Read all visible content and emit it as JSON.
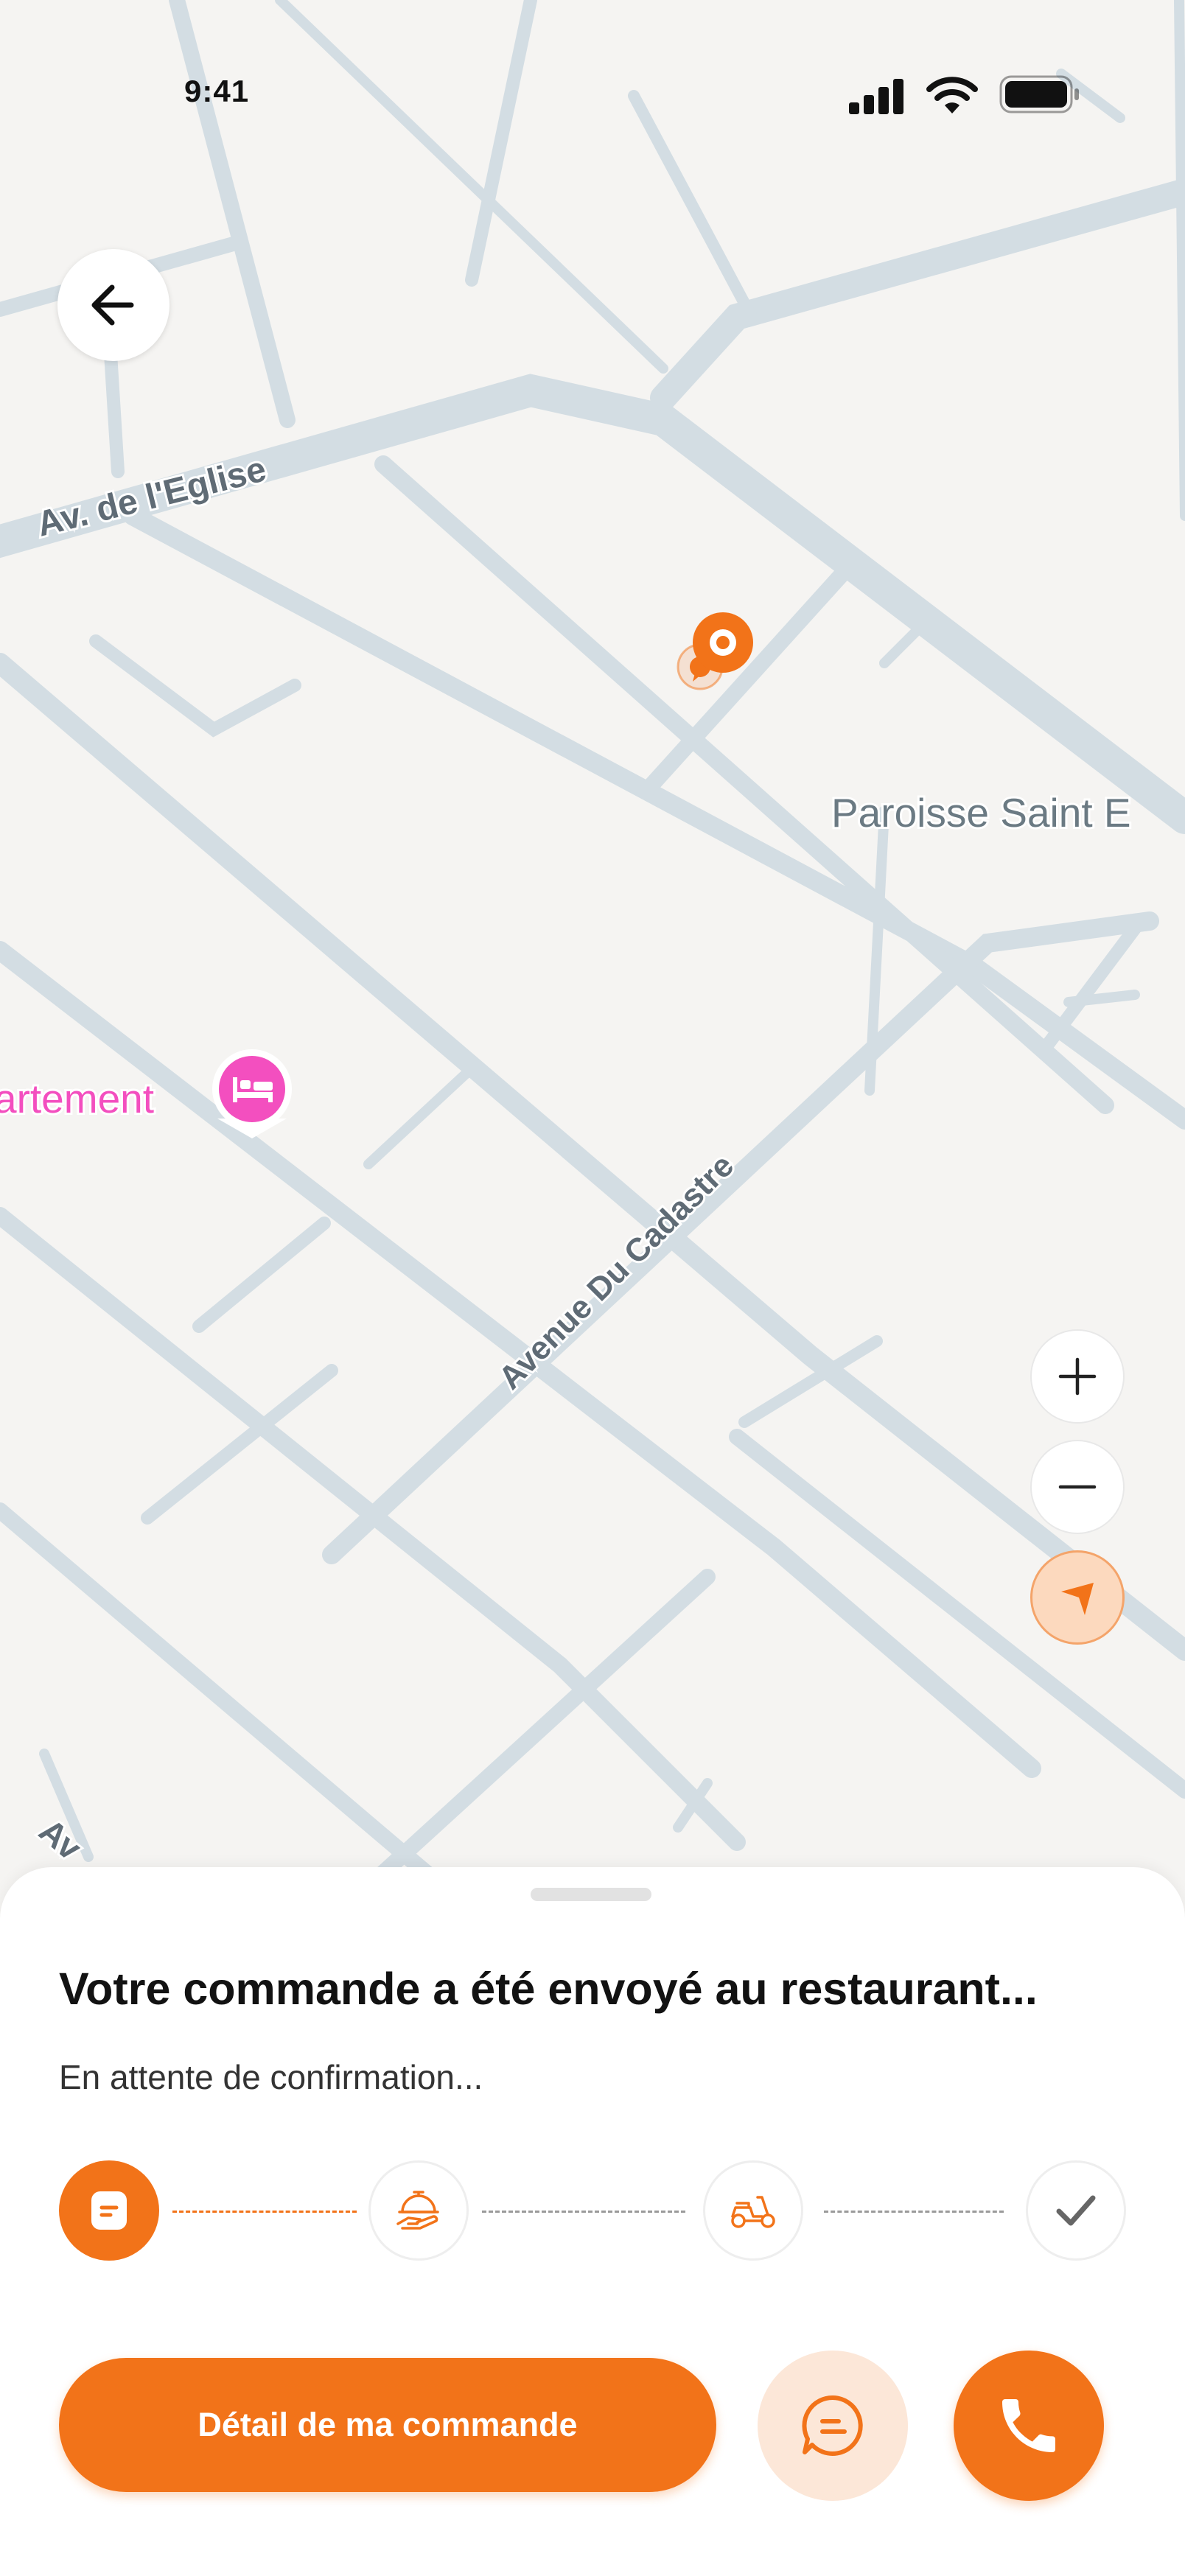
{
  "status_bar": {
    "time": "9:41"
  },
  "map": {
    "street_labels": [
      "Av. de l'Eglise",
      "Avenue Du Cadastre",
      "Av"
    ],
    "poi_labels": [
      "Paroisse Saint E",
      "artement"
    ],
    "colors": {
      "road": "#d3dde3",
      "background": "#f5f4f2",
      "accent": "#f27319",
      "poi_pink": "#f34fbf"
    }
  },
  "icons": {
    "back": "arrow-left-icon",
    "zoom_in": "plus-icon",
    "zoom_out": "minus-icon",
    "locate": "navigation-arrow-icon",
    "hotel": "bed-icon",
    "steps": [
      "receipt-icon",
      "cloche-icon",
      "scooter-icon",
      "checkmark-icon"
    ],
    "message": "chat-bubble-icon",
    "call": "phone-icon"
  },
  "sheet": {
    "title": "Votre commande a été envoyé au restaurant...",
    "subtitle": "En attente de confirmation...",
    "current_step": 1,
    "total_steps": 4,
    "primary_button": "Détail de ma commande"
  }
}
